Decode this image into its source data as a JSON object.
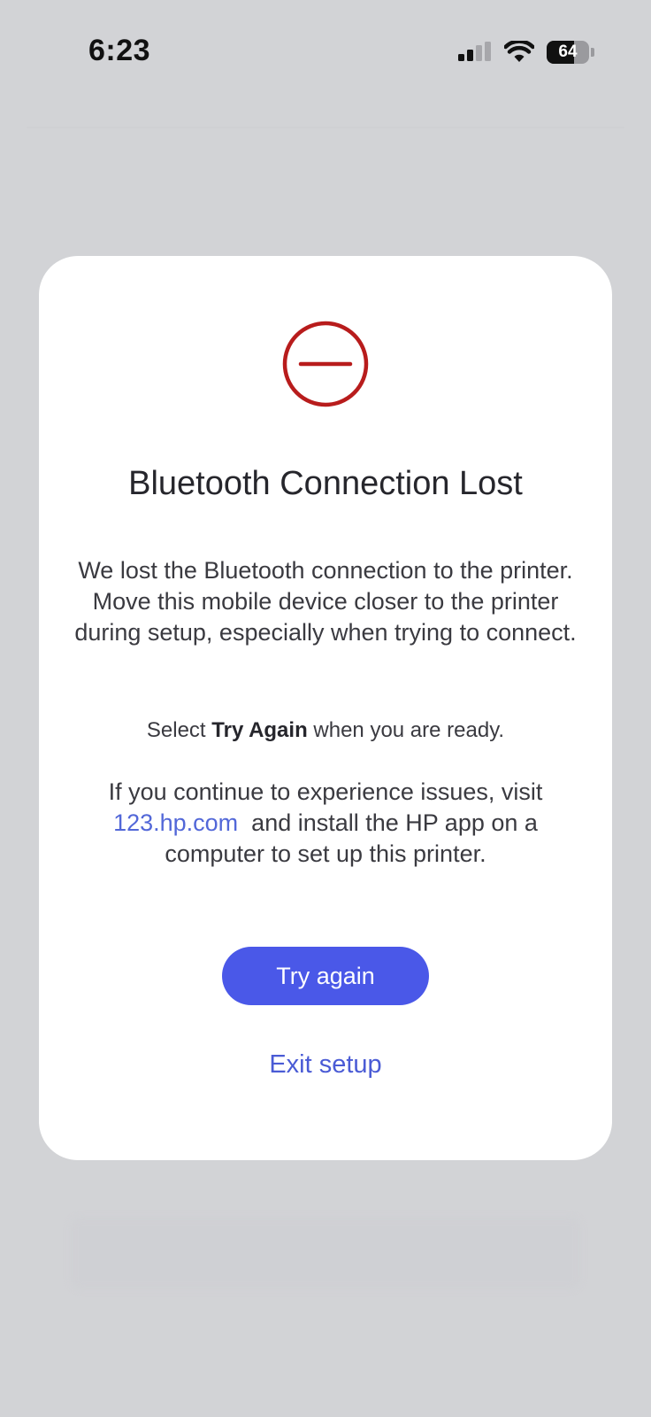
{
  "status_bar": {
    "time": "6:23",
    "battery_level": "64",
    "battery_fraction": 0.64,
    "signal_icon": "cellular-signal-icon",
    "wifi_icon": "wifi-icon",
    "battery_icon": "battery-icon"
  },
  "modal": {
    "icon": "error-minus-circle-icon",
    "icon_color": "#b81c1c",
    "title": "Bluetooth Connection Lost",
    "message": "We lost the Bluetooth connection to the printer. Move this mobile device closer to the printer during setup, especially when trying to connect.",
    "select_prefix": "Select ",
    "select_emphasis": "Try Again",
    "select_suffix": " when you are ready.",
    "issues_prefix": "If you continue to experience issues, visit",
    "issues_link": "123.hp.com",
    "issues_suffix": "and install the HP app on a computer to set up this printer.",
    "primary_button": "Try again",
    "secondary_link": "Exit setup"
  },
  "colors": {
    "accent": "#4a58e8",
    "link": "#5267d8",
    "error": "#b81c1c",
    "overlay": "#d2d3d6"
  }
}
